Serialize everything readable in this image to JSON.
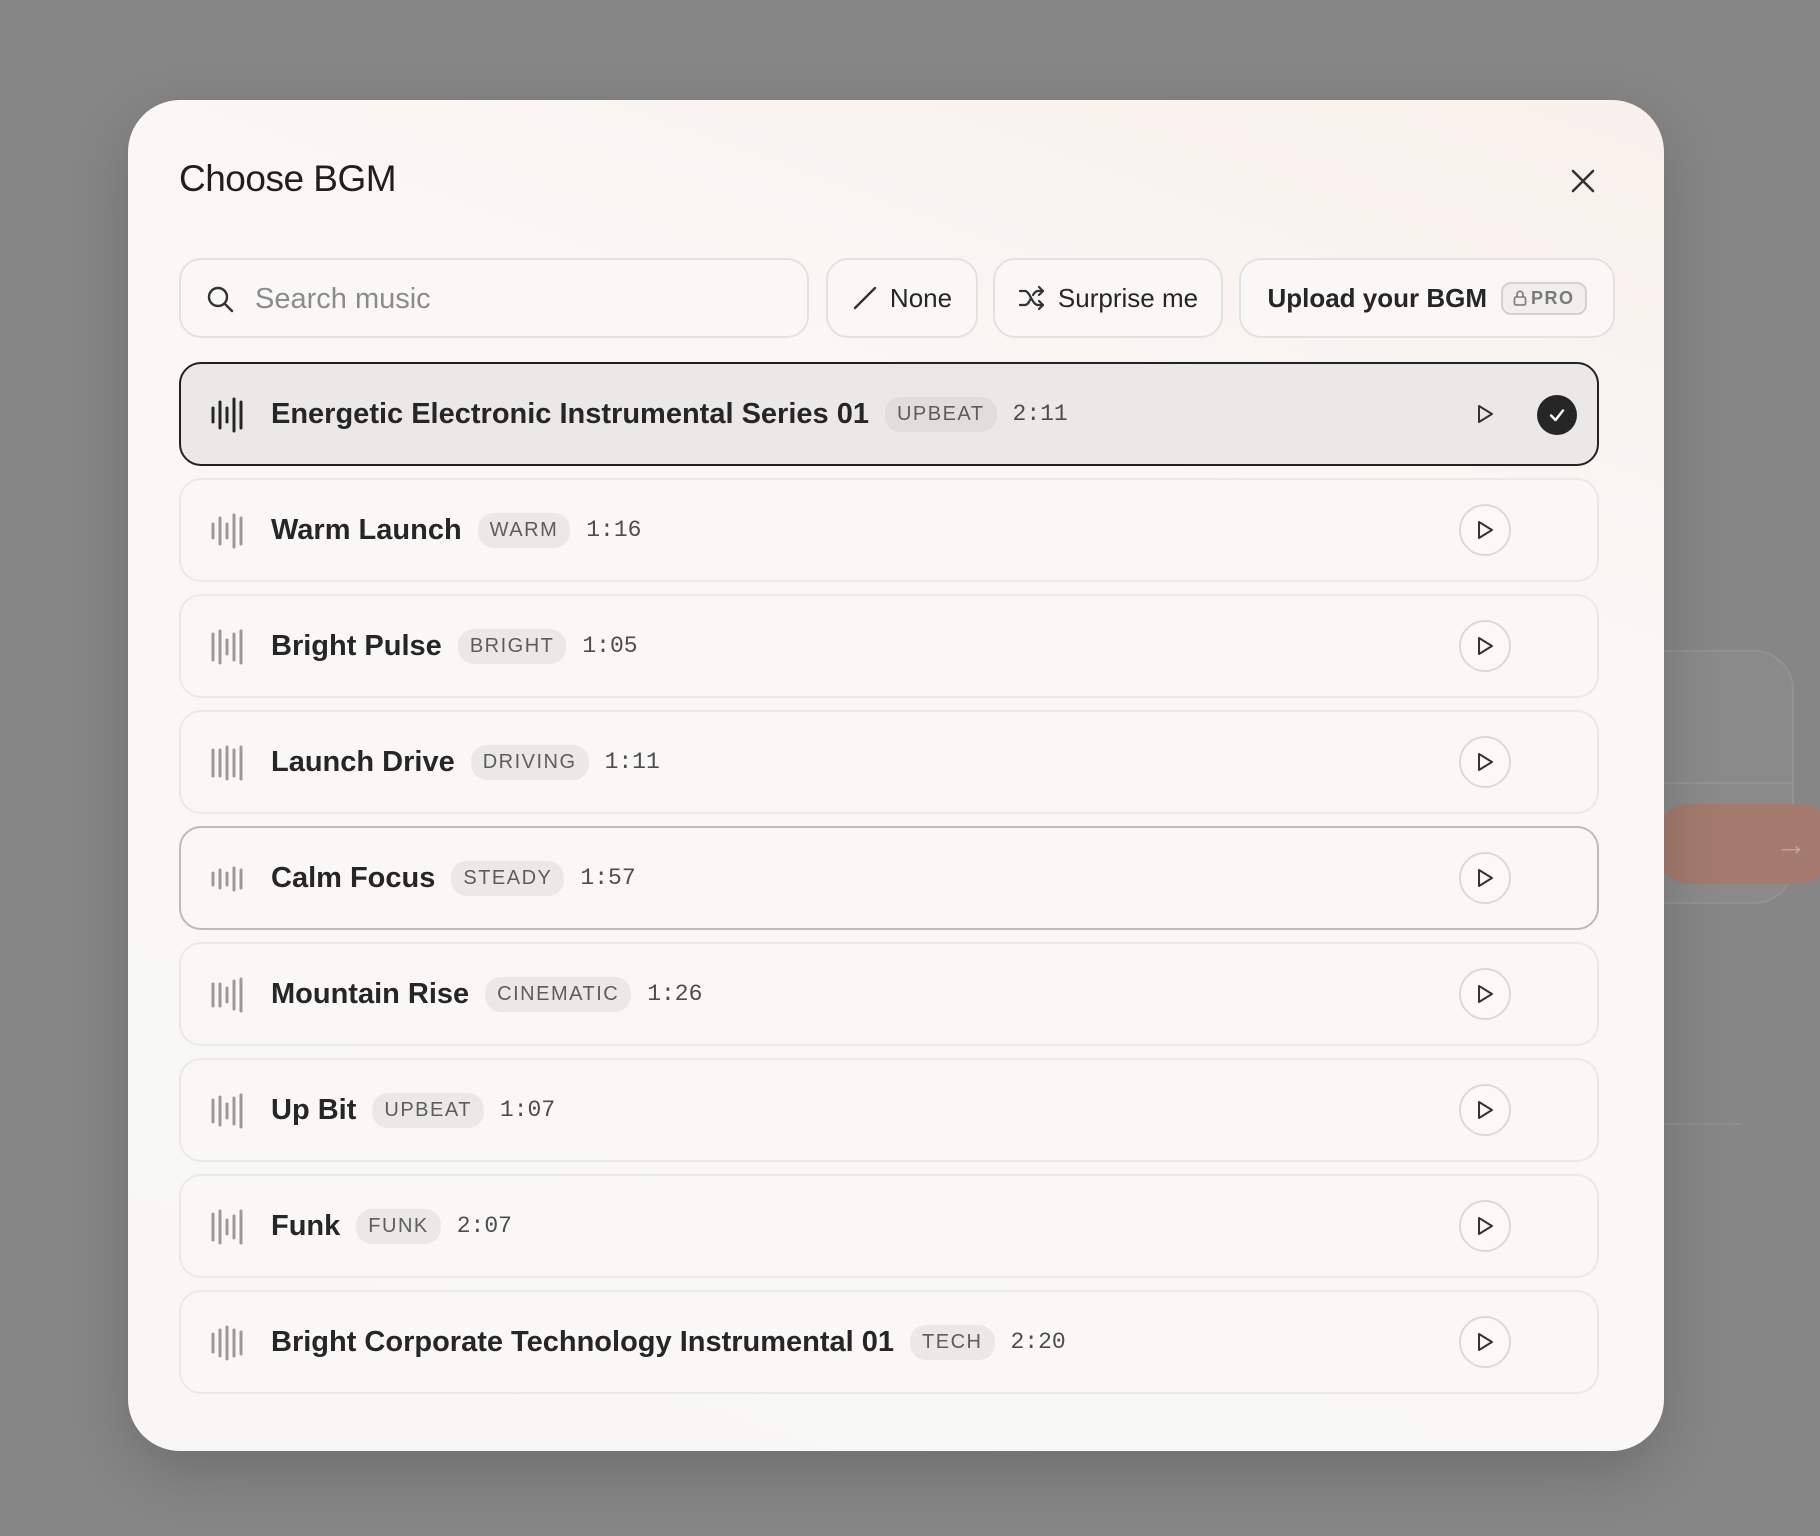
{
  "modal": {
    "title": "Choose BGM"
  },
  "toolbar": {
    "search_placeholder": "Search music",
    "none_label": "None",
    "surprise_label": "Surprise me",
    "upload_label": "Upload your BGM",
    "pro_label": "PRO"
  },
  "tracks": [
    {
      "name": "Energetic Electronic Instrumental Series 01",
      "tag": "UPBEAT",
      "duration": "2:11",
      "selected": true
    },
    {
      "name": "Warm Launch",
      "tag": "WARM",
      "duration": "1:16"
    },
    {
      "name": "Bright Pulse",
      "tag": "BRIGHT",
      "duration": "1:05"
    },
    {
      "name": "Launch Drive",
      "tag": "DRIVING",
      "duration": "1:11"
    },
    {
      "name": "Calm Focus",
      "tag": "STEADY",
      "duration": "1:57"
    },
    {
      "name": "Mountain Rise",
      "tag": "CINEMATIC",
      "duration": "1:26"
    },
    {
      "name": "Up Bit",
      "tag": "UPBEAT",
      "duration": "1:07"
    },
    {
      "name": "Funk",
      "tag": "FUNK",
      "duration": "2:07"
    },
    {
      "name": "Bright Corporate Technology Instrumental 01",
      "tag": "TECH",
      "duration": "2:20"
    }
  ],
  "colors": {
    "overlay": "#868686",
    "modal_bg": "#f9f8f6",
    "selected_bg": "#ebe9e7",
    "accent_dark": "#262626",
    "background_cta": "#a47a6e"
  }
}
